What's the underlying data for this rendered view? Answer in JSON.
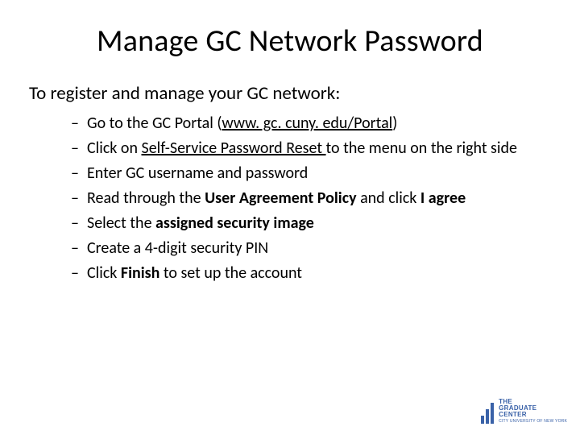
{
  "title": "Manage GC Network Password",
  "intro": "To register and manage your GC network:",
  "bullets": {
    "b0": {
      "pre": "Go to the GC Portal (",
      "link": "www. gc. cuny. edu/Portal",
      "post": ")"
    },
    "b1": {
      "pre": "Click on ",
      "link": "Self-Service Password Reset ",
      "post": "to the menu on the right side"
    },
    "b2": {
      "text": "Enter GC username and password"
    },
    "b3": {
      "pre": "Read through the ",
      "bold1": "User Agreement Policy ",
      "mid": "and click ",
      "bold2": "I agree"
    },
    "b4": {
      "pre": "Select the ",
      "bold": "assigned security image"
    },
    "b5": {
      "text": "Create a 4-digit security PIN"
    },
    "b6": {
      "pre": "Click ",
      "bold": "Finish ",
      "post": "to set up the account"
    }
  },
  "logo": {
    "line1": "THE",
    "line2": "GRADUATE",
    "line3": "CENTER",
    "sub": "CITY UNIVERSITY OF NEW YORK"
  },
  "colors": {
    "brand": "#3a62a8"
  }
}
